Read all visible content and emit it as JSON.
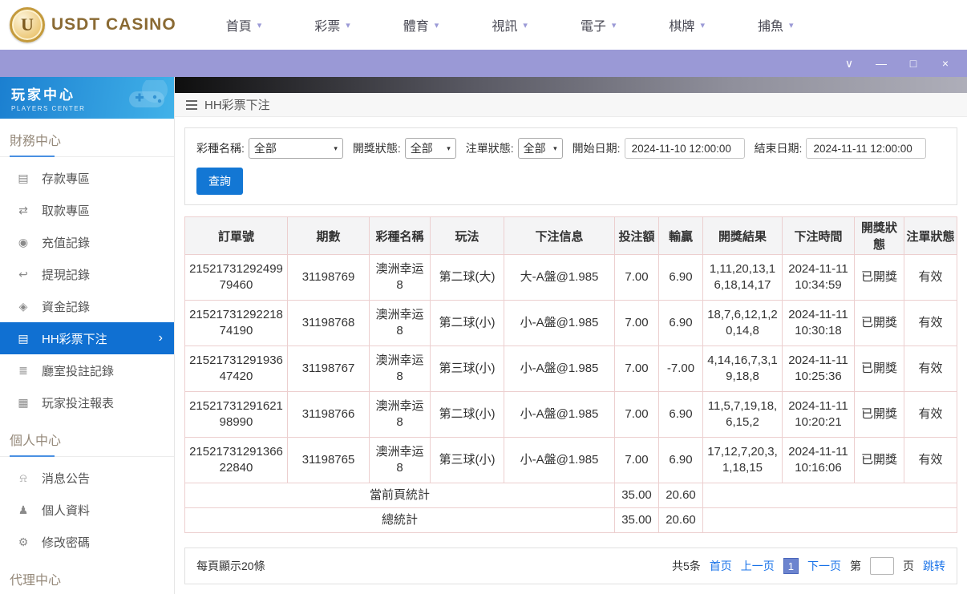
{
  "topnav": {
    "brand": "USDT CASINO",
    "items": [
      "首頁",
      "彩票",
      "體育",
      "視訊",
      "電子",
      "棋牌",
      "捕魚"
    ]
  },
  "sidebar": {
    "title": "玩家中心",
    "subtitle": "PLAYERS CENTER",
    "sections": [
      {
        "header": "財務中心",
        "items": [
          {
            "id": "deposit",
            "label": "存款專區",
            "icon": "deposit-card-icon",
            "glyph": "▤"
          },
          {
            "id": "withdraw",
            "label": "取款專區",
            "icon": "withdraw-card-icon",
            "glyph": "⇄"
          },
          {
            "id": "recharge-record",
            "label": "充值記錄",
            "icon": "recharge-record-icon",
            "glyph": "◉"
          },
          {
            "id": "withdrawal-record",
            "label": "提現記錄",
            "icon": "withdrawal-record-icon",
            "glyph": "↩"
          },
          {
            "id": "funds-record",
            "label": "資金記錄",
            "icon": "money-bag-icon",
            "glyph": "◈"
          },
          {
            "id": "hh-lottery-bet",
            "label": "HH彩票下注",
            "icon": "lottery-bet-list-icon",
            "glyph": "▤",
            "active": true
          },
          {
            "id": "hall-bet-record",
            "label": "廳室投註記錄",
            "icon": "hall-bet-record-icon",
            "glyph": "≣"
          },
          {
            "id": "player-bet-report",
            "label": "玩家投注報表",
            "icon": "report-chart-icon",
            "glyph": "▦"
          }
        ]
      },
      {
        "header": "個人中心",
        "items": [
          {
            "id": "notice",
            "label": "消息公告",
            "icon": "bell-icon",
            "glyph": "⍾"
          },
          {
            "id": "profile",
            "label": "個人資料",
            "icon": "person-icon",
            "glyph": "♟"
          },
          {
            "id": "change-password",
            "label": "修改密碼",
            "icon": "gear-icon",
            "glyph": "⚙"
          }
        ]
      },
      {
        "header": "代理中心",
        "items": []
      }
    ]
  },
  "breadcrumb": {
    "title": "HH彩票下注"
  },
  "filters": {
    "lottery_label": "彩種名稱:",
    "lottery_value": "全部",
    "draw_status_label": "開獎狀態:",
    "draw_status_value": "全部",
    "order_status_label": "注單狀態:",
    "order_status_value": "全部",
    "start_label": "開始日期:",
    "start_value": "2024-11-10 12:00:00",
    "end_label": "結束日期:",
    "end_value": "2024-11-11 12:00:00",
    "search_button": "查詢"
  },
  "table": {
    "headers": [
      "訂單號",
      "期數",
      "彩種名稱",
      "玩法",
      "下注信息",
      "投注額",
      "輸贏",
      "開獎結果",
      "下注時間",
      "開獎狀態",
      "注單狀態"
    ],
    "rows": [
      [
        "2152173129249979460",
        "31198769",
        "澳洲幸运8",
        "第二球(大)",
        "大-A盤@1.985",
        "7.00",
        "6.90",
        "1,11,20,13,16,18,14,17",
        "2024-11-11 10:34:59",
        "已開獎",
        "有效"
      ],
      [
        "2152173129221874190",
        "31198768",
        "澳洲幸运8",
        "第二球(小)",
        "小-A盤@1.985",
        "7.00",
        "6.90",
        "18,7,6,12,1,20,14,8",
        "2024-11-11 10:30:18",
        "已開獎",
        "有效"
      ],
      [
        "2152173129193647420",
        "31198767",
        "澳洲幸运8",
        "第三球(小)",
        "小-A盤@1.985",
        "7.00",
        "-7.00",
        "4,14,16,7,3,19,18,8",
        "2024-11-11 10:25:36",
        "已開獎",
        "有效"
      ],
      [
        "2152173129162198990",
        "31198766",
        "澳洲幸运8",
        "第二球(小)",
        "小-A盤@1.985",
        "7.00",
        "6.90",
        "11,5,7,19,18,6,15,2",
        "2024-11-11 10:20:21",
        "已開獎",
        "有效"
      ],
      [
        "2152173129136622840",
        "31198765",
        "澳洲幸运8",
        "第三球(小)",
        "小-A盤@1.985",
        "7.00",
        "6.90",
        "17,12,7,20,3,1,18,15",
        "2024-11-11 10:16:06",
        "已開獎",
        "有效"
      ]
    ],
    "summary": [
      {
        "label": "當前頁統計",
        "bet": "35.00",
        "winloss": "20.60"
      },
      {
        "label": "總統計",
        "bet": "35.00",
        "winloss": "20.60"
      }
    ]
  },
  "pagination": {
    "page_size_text": "每頁顯示20條",
    "total_text": "共5条",
    "first": "首页",
    "prev": "上一页",
    "current": "1",
    "next": "下一页",
    "jump_prefix": "第",
    "jump_suffix": "页",
    "jump_button": "跳转"
  }
}
